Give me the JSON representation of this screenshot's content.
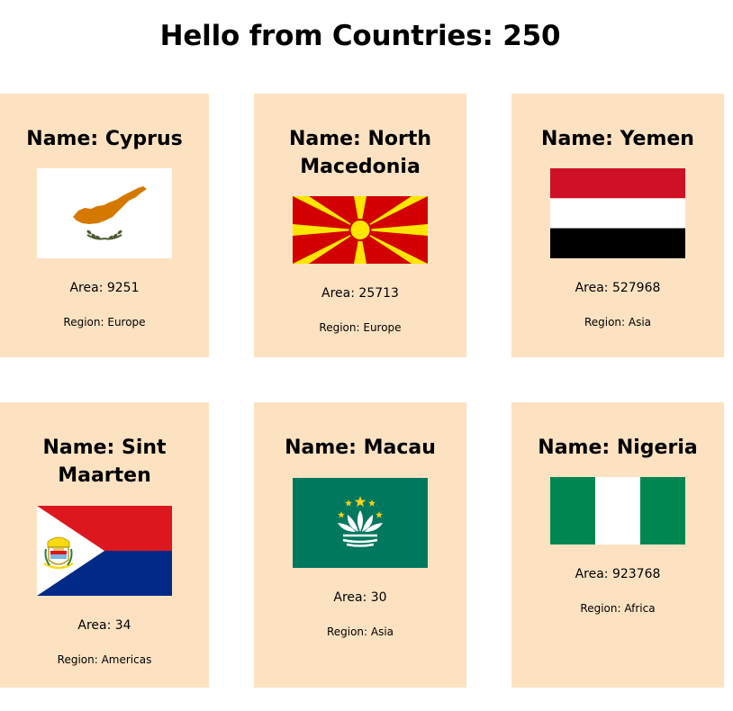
{
  "header": {
    "title": "Hello from Countries: 250"
  },
  "countries": [
    {
      "name": "Name: Cyprus",
      "area": "Area: 9251",
      "region": "Region: Europe",
      "flag": "cyprus-flag"
    },
    {
      "name": "Name: North Macedonia",
      "area": "Area: 25713",
      "region": "Region: Europe",
      "flag": "north-macedonia-flag"
    },
    {
      "name": "Name: Yemen",
      "area": "Area: 527968",
      "region": "Region: Asia",
      "flag": "yemen-flag"
    },
    {
      "name": "Name: Sint Maarten",
      "area": "Area: 34",
      "region": "Region: Americas",
      "flag": "sint-maarten-flag"
    },
    {
      "name": "Name: Macau",
      "area": "Area: 30",
      "region": "Region: Asia",
      "flag": "macau-flag"
    },
    {
      "name": "Name: Nigeria",
      "area": "Area: 923768",
      "region": "Region: Africa",
      "flag": "nigeria-flag"
    }
  ],
  "colors": {
    "card_background": "#fde2c2",
    "cyprus_orange": "#d57800",
    "macedonia_red": "#d20000",
    "macedonia_yellow": "#ffe600",
    "yemen_red": "#ce1126",
    "sint_maarten_red": "#dc171d",
    "sint_maarten_blue": "#012a87",
    "macau_green": "#00785e",
    "nigeria_green": "#008751"
  }
}
